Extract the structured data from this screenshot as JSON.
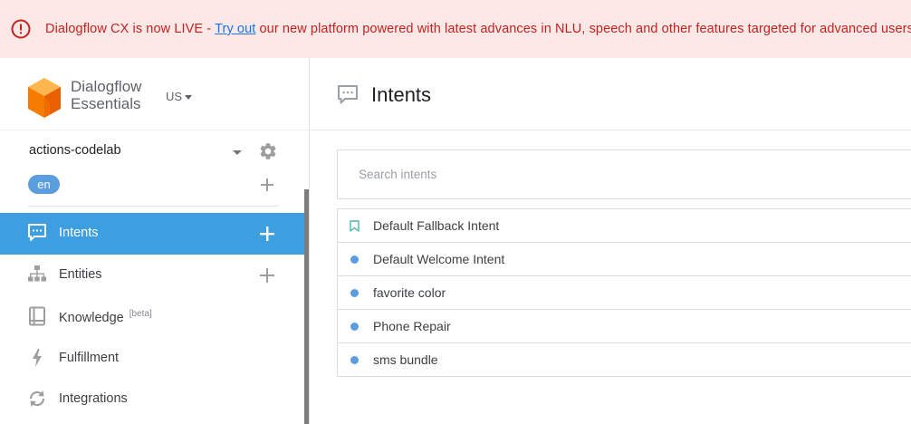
{
  "banner": {
    "prefix": "Dialogflow CX is now LIVE - ",
    "link": "Try out",
    "suffix": " our new platform powered with latest advances in NLU, speech and other features targeted for advanced users.",
    "icon": "alert-circle-icon",
    "color": "#c5221f"
  },
  "brand": {
    "line1": "Dialogflow",
    "line2": "Essentials",
    "region": "US",
    "logo": "dialogflow-cube-logo",
    "color": "#ff9800"
  },
  "agent": {
    "name": "actions-codelab",
    "language": "en"
  },
  "nav": [
    {
      "label": "Intents",
      "icon": "chat-bubble-icon",
      "active": true
    },
    {
      "label": "Entities",
      "icon": "hierarchy-icon"
    },
    {
      "label": "Knowledge",
      "badge": "[beta]",
      "icon": "book-icon"
    },
    {
      "label": "Fulfillment",
      "icon": "bolt-icon"
    },
    {
      "label": "Integrations",
      "icon": "sync-icon"
    }
  ],
  "main": {
    "title": "Intents",
    "search_placeholder": "Search intents",
    "intents": [
      {
        "name": "Default Fallback Intent",
        "marker": "bookmark-icon"
      },
      {
        "name": "Default Welcome Intent",
        "marker": "dot"
      },
      {
        "name": "favorite color",
        "marker": "dot"
      },
      {
        "name": "Phone Repair",
        "marker": "dot"
      },
      {
        "name": "sms bundle",
        "marker": "dot"
      }
    ]
  },
  "colors": {
    "accent": "#3d9ee0",
    "banner_bg": "#fce8e6",
    "dot": "#5b9ee0"
  }
}
